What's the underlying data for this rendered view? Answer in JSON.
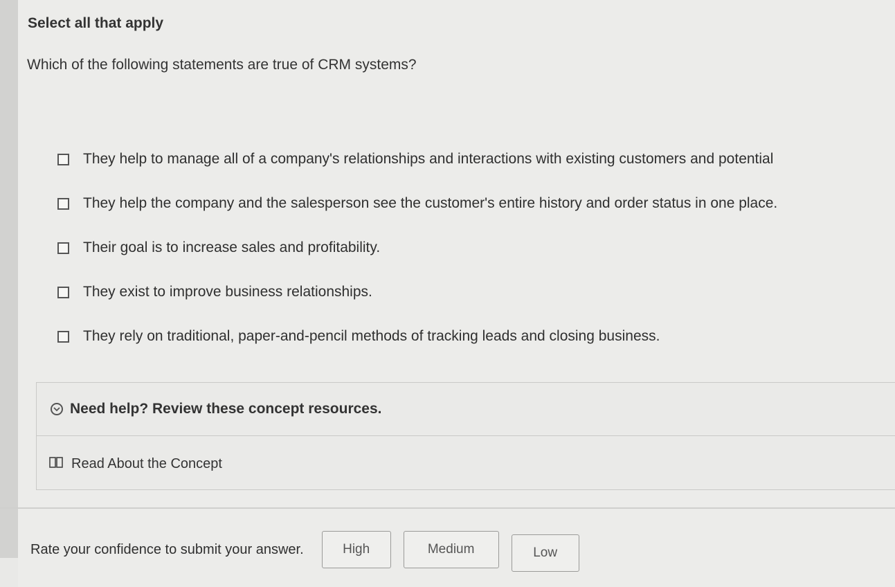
{
  "heading": "Select all that apply",
  "question": "Which of the following statements are true of CRM systems?",
  "options": [
    {
      "label": "They help to manage all of a company's relationships and interactions with existing customers and potential",
      "checked": false
    },
    {
      "label": "They help the company and the salesperson see the customer's entire history and order status in one place.",
      "checked": false
    },
    {
      "label": "Their goal is to increase sales and profitability.",
      "checked": false
    },
    {
      "label": "They exist to improve business relationships.",
      "checked": false
    },
    {
      "label": "They rely on traditional, paper-and-pencil methods of tracking leads and closing business.",
      "checked": false
    }
  ],
  "help": {
    "title": "Need help? Review these concept resources.",
    "link_label": "Read About the Concept",
    "toggle_icon": "chevron-down-circle-icon",
    "link_icon": "book-icon"
  },
  "confidence": {
    "label": "Rate your confidence to submit your answer.",
    "buttons": [
      "High",
      "Medium",
      "Low"
    ]
  }
}
